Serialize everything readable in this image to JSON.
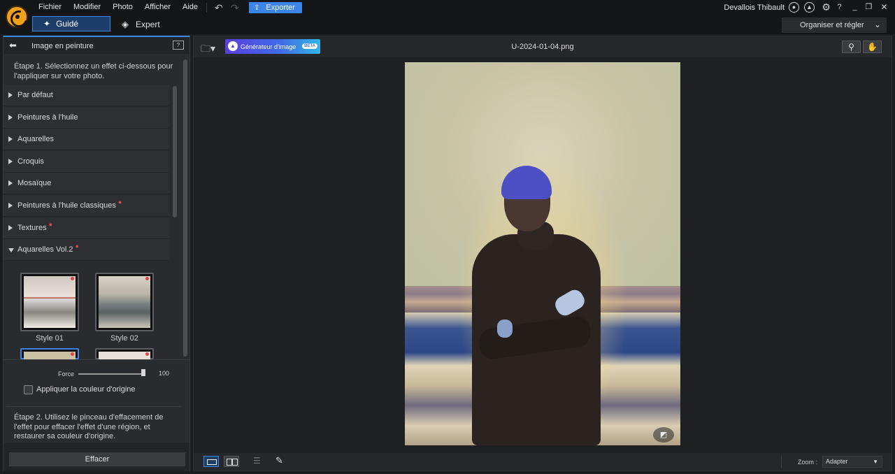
{
  "menu": {
    "items": [
      "Fichier",
      "Modifier",
      "Photo",
      "Afficher",
      "Aide"
    ],
    "export_label": "Exporter",
    "user_name": "Devallois Thibault"
  },
  "modes": {
    "guide_label": "Guidé",
    "expert_label": "Expert",
    "organize_label": "Organiser et régler"
  },
  "left_panel": {
    "title": "Image en peinture",
    "help_label": "?",
    "step1": "Étape 1. Sélectionnez un effet ci-dessous pour l'appliquer sur votre photo.",
    "categories": [
      {
        "label": "Par défaut",
        "new": false,
        "open": false
      },
      {
        "label": "Peintures à l'huile",
        "new": false,
        "open": false
      },
      {
        "label": "Aquarelles",
        "new": false,
        "open": false
      },
      {
        "label": "Croquis",
        "new": false,
        "open": false
      },
      {
        "label": "Mosaïque",
        "new": false,
        "open": false
      },
      {
        "label": "Peintures à l'huile classiques",
        "new": true,
        "open": false
      },
      {
        "label": "Textures",
        "new": true,
        "open": false
      },
      {
        "label": "Aquarelles Vol.2",
        "new": true,
        "open": true
      }
    ],
    "styles": [
      {
        "label": "Style 01",
        "selected": false
      },
      {
        "label": "Style 02",
        "selected": false
      },
      {
        "label": "",
        "selected": true
      },
      {
        "label": "",
        "selected": false
      }
    ],
    "force_label": "Force",
    "force_value": "100",
    "force_fraction": 1.0,
    "origin_color_label": "Appliquer la couleur d'origine",
    "origin_color_checked": false,
    "step2": "Étape 2. Utilisez le pinceau d'effacement de l'effet pour effacer l'effet d'une région, et restaurer sa couleur d'origine.",
    "erase_label": "Effacer"
  },
  "workspace": {
    "generator_label": "Générateur d'image",
    "beta_label": "BETA",
    "filename": "U-2024-01-04.png",
    "zoom_label": "Zoom :",
    "zoom_value": "Adapter"
  },
  "colors": {
    "accent": "#3b84e8",
    "new_dot": "#e04545",
    "logo": "#f0a11b"
  }
}
